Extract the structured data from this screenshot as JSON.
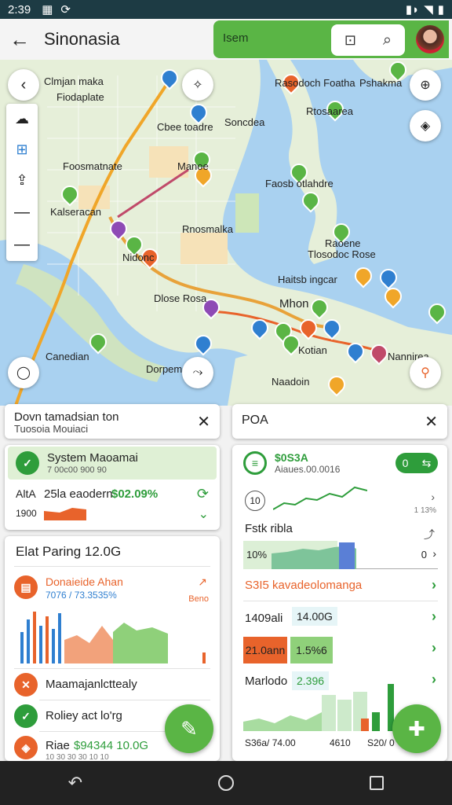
{
  "status": {
    "time": "2:39"
  },
  "header": {
    "title": "Sinonasia",
    "search_label": "Isem"
  },
  "map": {
    "labels": [
      "Clmjan maka",
      "Rasodoch Foatha",
      "Foosmatnate",
      "Faosb otlahdre",
      "Manoe",
      "Kalseracan",
      "Nidonc",
      "Dlose Rosa",
      "Canedian",
      "Rnosmalka",
      "Dorpeman",
      "Pshakma",
      "Fiodaplate",
      "Soncdea",
      "Cbee toadre",
      "Tlosodoc Rose",
      "Rtosaarea",
      "Raoene",
      "Haitsb ingcar",
      "Mhon",
      "Kotian",
      "Nannirea",
      "Naadoin"
    ],
    "colors": {
      "water": "#a9d1f0",
      "land": "#e6efd9",
      "route": "#f0a629",
      "route_alt": "#e8632b"
    }
  },
  "panel_left": {
    "header": {
      "title": "Dovn tamadsian ton",
      "subtitle": "Tuosoia Mouiaci"
    },
    "system": {
      "title": "System Maoamai",
      "subtitle": "7 00c00 900 90"
    },
    "stats": {
      "prefix": "AltA",
      "label": "25la eaodern",
      "value": "$02.09%",
      "sub": "1900"
    },
    "parking": {
      "title": "Elat Paring 12.0G"
    },
    "donate": {
      "title": "Donaieide Ahan",
      "sub": "7076 / 73.3535%",
      "side": "Beno"
    },
    "items": [
      {
        "label": "Maamajanlcttealy"
      },
      {
        "label": "Roliey act lo'rg"
      },
      {
        "label": "Riae",
        "value": "$94344 10.0G",
        "sub": "10 30 30 30 10 10"
      }
    ]
  },
  "panel_right": {
    "header": {
      "title": "POA"
    },
    "summary": {
      "value": "$0S3A",
      "sub": "Aiaues.00.0016",
      "toggle": "0"
    },
    "chart1": {
      "badge": "10",
      "side": "1 13%"
    },
    "stk": {
      "label": "Fstk ribla",
      "value": "10%",
      "right": "0"
    },
    "rows": [
      {
        "label": "S3I5 kavadeolomanga",
        "color": "#e8632b"
      },
      {
        "label": "1409ali",
        "value": "14.00G"
      },
      {
        "label": "21.0ann",
        "value": "1.5%6"
      },
      {
        "label": "Marlodo",
        "value": "2.396"
      }
    ],
    "axis": [
      "S36a/ 74.00",
      "4610",
      "S20/ 0"
    ]
  }
}
